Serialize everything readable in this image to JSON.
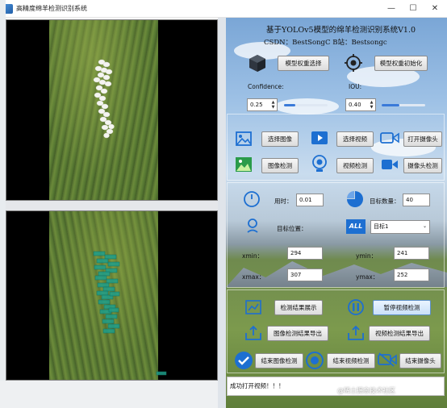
{
  "window": {
    "title": "高精度绵羊检测识别系统",
    "minimize": "—",
    "maximize": "☐",
    "close": "✕"
  },
  "header": {
    "title": "基于YOLOv5模型的绵羊检测识别系统V1.0",
    "subtitle": "CSDN：BestSongC   B站：Bestsongc"
  },
  "model": {
    "select_label": "模型权重选择",
    "init_label": "模型权重初始化"
  },
  "params": {
    "confidence_label": "Confidence:",
    "confidence_value": "0.25",
    "confidence_level": 0.25,
    "iou_label": "IOU:",
    "iou_value": "0.40",
    "iou_level": 0.4
  },
  "inputs": {
    "select_image": "选择图像",
    "select_video": "选择视频",
    "open_camera": "打开摄像头",
    "image_detect": "图像检测",
    "video_detect": "视频检测",
    "camera_detect": "摄像头检测"
  },
  "stats": {
    "time_label": "用时：",
    "time_value": "0.01",
    "count_label": "目标数量：",
    "count_value": "40",
    "position_label": "目标位置：",
    "target_select": "目标1",
    "all_badge": "ALL",
    "xmin_label": "xmin：",
    "xmin_value": "294",
    "ymin_label": "ymin：",
    "ymin_value": "241",
    "xmax_label": "xmax：",
    "xmax_value": "307",
    "ymax_label": "ymax：",
    "ymax_value": "252"
  },
  "actions": {
    "show_results": "检测结果展示",
    "pause_video": "暂停视频检测",
    "export_image": "图像检测结果导出",
    "export_video": "视频检测结果导出",
    "end_image": "结束图像检测",
    "end_video": "结束视频检测",
    "end_camera": "结束摄像头"
  },
  "status": {
    "message": "成功打开视频！！！"
  },
  "watermark": "@稀土掘金技术社区",
  "colors": {
    "accent_blue": "#3a7ad9",
    "detection_box": "#1f9e8a",
    "sheep_white": "#f4f4f0"
  }
}
